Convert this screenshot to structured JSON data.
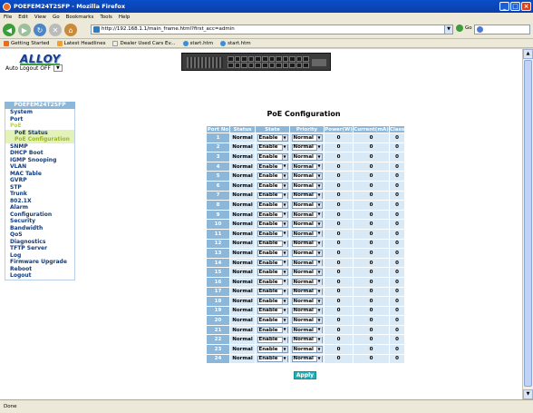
{
  "window": {
    "title": "POEFEM24T2SFP - Mozilla Firefox"
  },
  "menu": [
    "File",
    "Edit",
    "View",
    "Go",
    "Bookmarks",
    "Tools",
    "Help"
  ],
  "address": {
    "url": "http://192.168.1.1/main_frame.html?first_acc=admin",
    "go_label": "Go"
  },
  "bookmarks": [
    {
      "label": "Getting Started",
      "icon": "firefox-icon"
    },
    {
      "label": "Latest Headlines",
      "icon": "rss-icon"
    },
    {
      "label": "Dealer Used Cars Ev...",
      "icon": "page-icon"
    },
    {
      "label": "start.htm",
      "icon": "globe-icon"
    },
    {
      "label": "start.htm",
      "icon": "globe-icon"
    }
  ],
  "header": {
    "logo_text": "ALLOY",
    "auto_logout_label": "Auto Logout OFF"
  },
  "sidebar": {
    "title": "POEFEM24T2SFP",
    "items": [
      {
        "label": "System",
        "type": "item"
      },
      {
        "label": "Port",
        "type": "item"
      },
      {
        "label": "PoE",
        "type": "poe"
      },
      {
        "label": "PoE Status",
        "type": "sub"
      },
      {
        "label": "PoE Configuration",
        "type": "sub-active"
      },
      {
        "label": "SNMP",
        "type": "item"
      },
      {
        "label": "DHCP Boot",
        "type": "item"
      },
      {
        "label": "IGMP Snooping",
        "type": "item"
      },
      {
        "label": "VLAN",
        "type": "item"
      },
      {
        "label": "MAC Table",
        "type": "item"
      },
      {
        "label": "GVRP",
        "type": "item"
      },
      {
        "label": "STP",
        "type": "item"
      },
      {
        "label": "Trunk",
        "type": "item"
      },
      {
        "label": "802.1X",
        "type": "item"
      },
      {
        "label": "Alarm",
        "type": "item"
      },
      {
        "label": "Configuration",
        "type": "item"
      },
      {
        "label": "Security",
        "type": "item"
      },
      {
        "label": "Bandwidth",
        "type": "item"
      },
      {
        "label": "QoS",
        "type": "item"
      },
      {
        "label": "Diagnostics",
        "type": "item"
      },
      {
        "label": "TFTP Server",
        "type": "item"
      },
      {
        "label": "Log",
        "type": "item"
      },
      {
        "label": "Firmware Upgrade",
        "type": "item"
      },
      {
        "label": "Reboot",
        "type": "item"
      },
      {
        "label": "Logout",
        "type": "item"
      }
    ]
  },
  "main": {
    "title": "PoE Configuration",
    "columns": [
      "Port No",
      "Status",
      "State",
      "Priority",
      "Power(W)",
      "Current(mA)",
      "Class"
    ],
    "rows": [
      {
        "port": "1",
        "status": "Normal",
        "state": "Enable",
        "priority": "Normal",
        "power": "0",
        "current": "0",
        "class": "0"
      },
      {
        "port": "2",
        "status": "Normal",
        "state": "Enable",
        "priority": "Normal",
        "power": "0",
        "current": "0",
        "class": "0"
      },
      {
        "port": "3",
        "status": "Normal",
        "state": "Enable",
        "priority": "Normal",
        "power": "0",
        "current": "0",
        "class": "0"
      },
      {
        "port": "4",
        "status": "Normal",
        "state": "Enable",
        "priority": "Normal",
        "power": "0",
        "current": "0",
        "class": "0"
      },
      {
        "port": "5",
        "status": "Normal",
        "state": "Enable",
        "priority": "Normal",
        "power": "0",
        "current": "0",
        "class": "0"
      },
      {
        "port": "6",
        "status": "Normal",
        "state": "Enable",
        "priority": "Normal",
        "power": "0",
        "current": "0",
        "class": "0"
      },
      {
        "port": "7",
        "status": "Normal",
        "state": "Enable",
        "priority": "Normal",
        "power": "0",
        "current": "0",
        "class": "0"
      },
      {
        "port": "8",
        "status": "Normal",
        "state": "Enable",
        "priority": "Normal",
        "power": "0",
        "current": "0",
        "class": "0"
      },
      {
        "port": "9",
        "status": "Normal",
        "state": "Enable",
        "priority": "Normal",
        "power": "0",
        "current": "0",
        "class": "0"
      },
      {
        "port": "10",
        "status": "Normal",
        "state": "Enable",
        "priority": "Normal",
        "power": "0",
        "current": "0",
        "class": "0"
      },
      {
        "port": "11",
        "status": "Normal",
        "state": "Enable",
        "priority": "Normal",
        "power": "0",
        "current": "0",
        "class": "0"
      },
      {
        "port": "12",
        "status": "Normal",
        "state": "Enable",
        "priority": "Normal",
        "power": "0",
        "current": "0",
        "class": "0"
      },
      {
        "port": "13",
        "status": "Normal",
        "state": "Enable",
        "priority": "Normal",
        "power": "0",
        "current": "0",
        "class": "0"
      },
      {
        "port": "14",
        "status": "Normal",
        "state": "Enable",
        "priority": "Normal",
        "power": "0",
        "current": "0",
        "class": "0"
      },
      {
        "port": "15",
        "status": "Normal",
        "state": "Enable",
        "priority": "Normal",
        "power": "0",
        "current": "0",
        "class": "0"
      },
      {
        "port": "16",
        "status": "Normal",
        "state": "Enable",
        "priority": "Normal",
        "power": "0",
        "current": "0",
        "class": "0"
      },
      {
        "port": "17",
        "status": "Normal",
        "state": "Enable",
        "priority": "Normal",
        "power": "0",
        "current": "0",
        "class": "0"
      },
      {
        "port": "18",
        "status": "Normal",
        "state": "Enable",
        "priority": "Normal",
        "power": "0",
        "current": "0",
        "class": "0"
      },
      {
        "port": "19",
        "status": "Normal",
        "state": "Enable",
        "priority": "Normal",
        "power": "0",
        "current": "0",
        "class": "0"
      },
      {
        "port": "20",
        "status": "Normal",
        "state": "Enable",
        "priority": "Normal",
        "power": "0",
        "current": "0",
        "class": "0"
      },
      {
        "port": "21",
        "status": "Normal",
        "state": "Enable",
        "priority": "Normal",
        "power": "0",
        "current": "0",
        "class": "0"
      },
      {
        "port": "22",
        "status": "Normal",
        "state": "Enable",
        "priority": "Normal",
        "power": "0",
        "current": "0",
        "class": "0"
      },
      {
        "port": "23",
        "status": "Normal",
        "state": "Enable",
        "priority": "Normal",
        "power": "0",
        "current": "0",
        "class": "0"
      },
      {
        "port": "24",
        "status": "Normal",
        "state": "Enable",
        "priority": "Normal",
        "power": "0",
        "current": "0",
        "class": "0"
      }
    ],
    "apply_label": "Apply"
  },
  "status": {
    "text": "Done"
  },
  "colors": {
    "accent_header": "#8cb7d9",
    "row_bg": "#d9e9f6",
    "apply_button": "#1fb1b8",
    "submenu_bg": "#e2f2b8"
  }
}
